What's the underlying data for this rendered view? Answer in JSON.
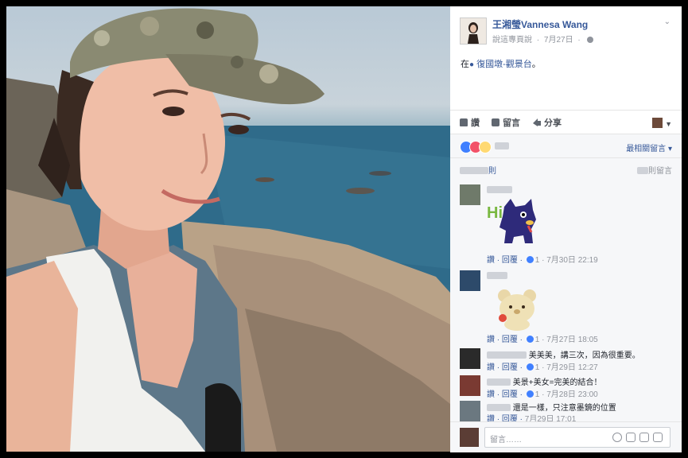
{
  "post": {
    "author": "王湘瑩Vannesa Wang",
    "page_label": "說這專頁說",
    "date": "7月27日",
    "checkin_prefix": "在",
    "checkin_place": "復國墩-觀景台",
    "checkin_suffix": "。"
  },
  "actions": {
    "like": "讚",
    "comment": "留言",
    "share": "分享"
  },
  "reactions": {
    "sort_label": "最相關留言"
  },
  "view_more": {
    "left_suffix": "則",
    "right_suffix": "則留言"
  },
  "comments": [
    {
      "text": "",
      "sticker": "dog-hi-sticker",
      "sticker_text": "Hi!",
      "reply_label": "讚 · 回覆 ·",
      "likes": "1",
      "time": "· 7月30日 22:19"
    },
    {
      "text": "",
      "sticker": "bear-sticker",
      "reply_label": "讚 · 回覆 ·",
      "likes": "1",
      "time": "· 7月27日 18:05"
    },
    {
      "text": "美美美，講三次，因為很重要。",
      "reply_label": "讚 · 回覆 ·",
      "likes": "1",
      "time": "· 7月29日 12:27"
    },
    {
      "text": "美景+美女=完美的結合！",
      "reply_label": "讚 · 回覆 ·",
      "likes": "1",
      "time": "· 7月28日 23:00"
    },
    {
      "text": "還是一樣，只注意墨鏡的位置",
      "reply_label": "讚 · 回覆 ·",
      "time": "7月29日 17:01"
    }
  ],
  "compose": {
    "placeholder": "留言……"
  },
  "colors": {
    "link": "#365899",
    "muted": "#90949c",
    "panel_bg": "#f6f7f9",
    "like_blue": "#4080ff",
    "love_red": "#f25268"
  }
}
